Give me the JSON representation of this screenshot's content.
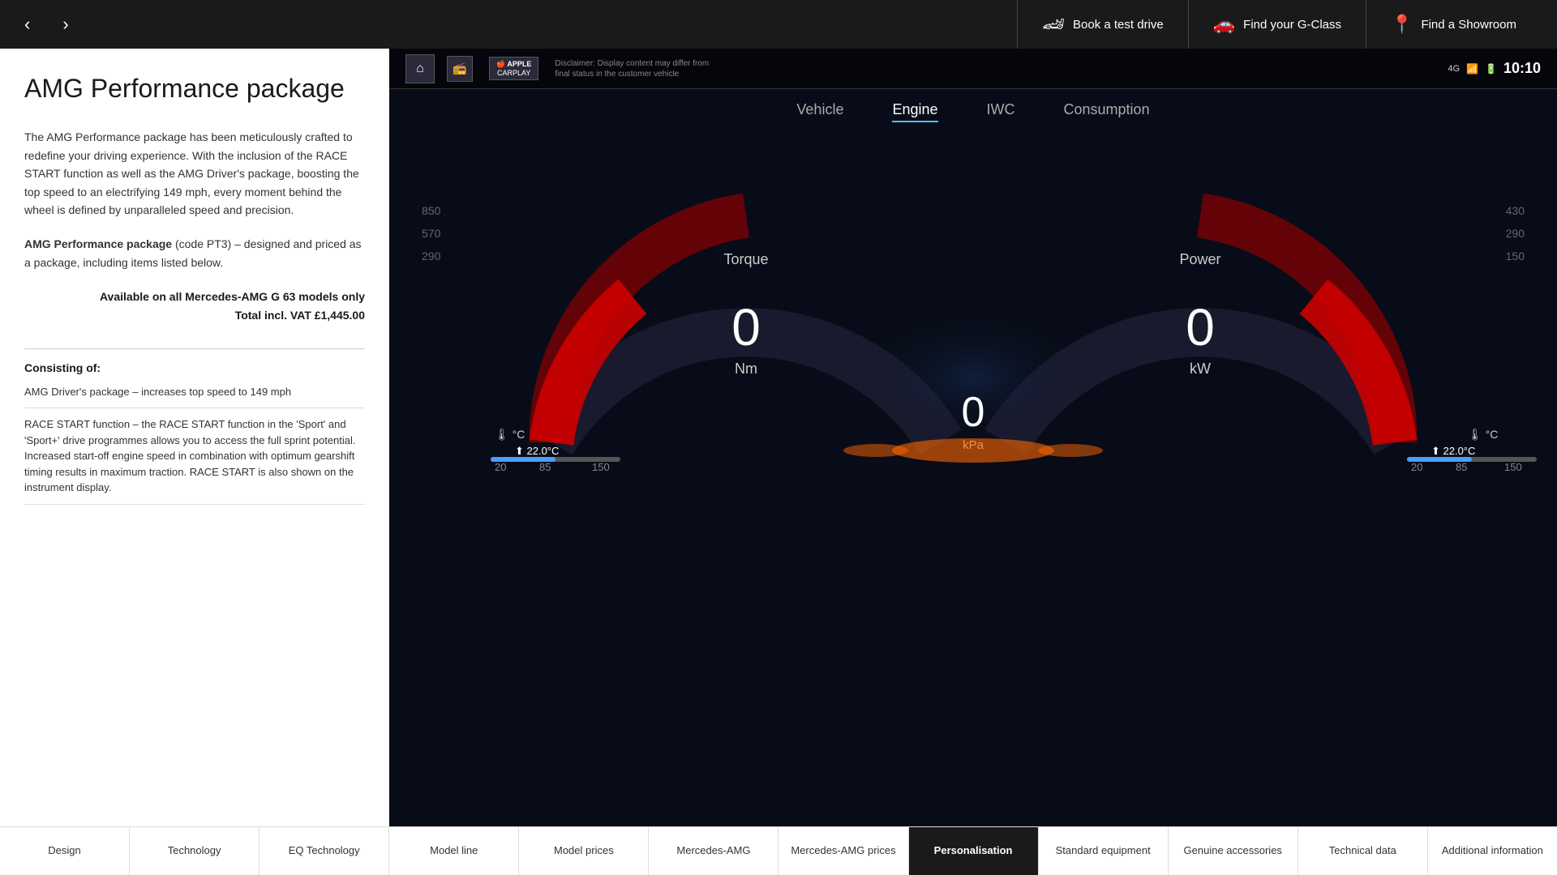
{
  "header": {
    "book_test_drive": "Book a test drive",
    "find_g_class": "Find your G-Class",
    "find_showroom": "Find a Showroom"
  },
  "nav": {
    "prev": "‹",
    "next": "›"
  },
  "page": {
    "title": "AMG Performance package",
    "description": "The AMG Performance package has been meticulously crafted to redefine your driving experience. With the inclusion of the RACE START function as well as the AMG Driver's package, boosting the top speed to an electrifying 149 mph, every moment behind the wheel is defined by unparalleled speed and precision.",
    "package_name_bold": "AMG Performance package",
    "package_name_rest": " (code PT3) – designed and priced as a package, including items listed below.",
    "availability_line1": "Available on all Mercedes-AMG G 63 models only",
    "availability_line2": "Total incl. VAT £1,445.00",
    "consisting_of": "Consisting of:",
    "items": [
      {
        "text": "AMG Driver's package – increases top speed to 149 mph"
      },
      {
        "text": "RACE START function – the RACE START function in the 'Sport' and 'Sport+' drive programmes allows you to access the full sprint potential. Increased start-off engine speed in combination with optimum gearshift timing results in maximum traction. RACE START is also shown on the instrument display."
      }
    ]
  },
  "dashboard": {
    "disclaimer": "Disclaimer: Display content may differ from final status in the customer vehicle",
    "time": "10:10",
    "tabs": [
      "Vehicle",
      "Engine",
      "IWC",
      "Consumption"
    ],
    "active_tab": "Engine",
    "torque_label": "Torque",
    "power_label": "Power",
    "torque_value": "0",
    "torque_unit": "Nm",
    "power_value": "0",
    "power_unit": "kW",
    "pressure_value": "0",
    "pressure_unit": "kPa",
    "gauge_numbers_left": [
      "850",
      "570",
      "290"
    ],
    "gauge_numbers_right": [
      "430",
      "290",
      "150"
    ],
    "apple_carplay": "APPLE\nCARPLAY",
    "temp_left": "22.0°C",
    "temp_right": "22.0°C"
  },
  "bottom_nav": {
    "items": [
      {
        "label": "Design",
        "active": false
      },
      {
        "label": "Technology",
        "active": false
      },
      {
        "label": "EQ Technology",
        "active": false
      },
      {
        "label": "Model line",
        "active": false
      },
      {
        "label": "Model prices",
        "active": false
      },
      {
        "label": "Mercedes-AMG",
        "active": false
      },
      {
        "label": "Mercedes-AMG prices",
        "active": false
      },
      {
        "label": "Personalisation",
        "active": true
      },
      {
        "label": "Standard equipment",
        "active": false
      },
      {
        "label": "Genuine accessories",
        "active": false
      },
      {
        "label": "Technical data",
        "active": false
      },
      {
        "label": "Additional information",
        "active": false
      }
    ]
  }
}
